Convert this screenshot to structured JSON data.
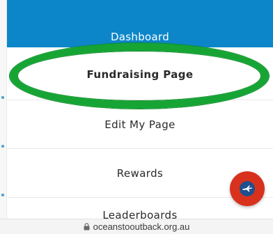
{
  "menu": {
    "dashboard_label": "Dashboard",
    "items": [
      {
        "label": "Fundraising Page"
      },
      {
        "label": "Edit My Page"
      },
      {
        "label": "Rewards"
      },
      {
        "label": "Leaderboards"
      }
    ]
  },
  "browser": {
    "url": "oceanstooutback.org.au",
    "lock_icon": "lock-icon"
  },
  "fab": {
    "icon": "plane-icon"
  },
  "colors": {
    "dashboard_bg": "#0c86c9",
    "highlight": "#16a534",
    "fab_bg": "#d8321e",
    "fab_inner": "#1e4f8f"
  }
}
